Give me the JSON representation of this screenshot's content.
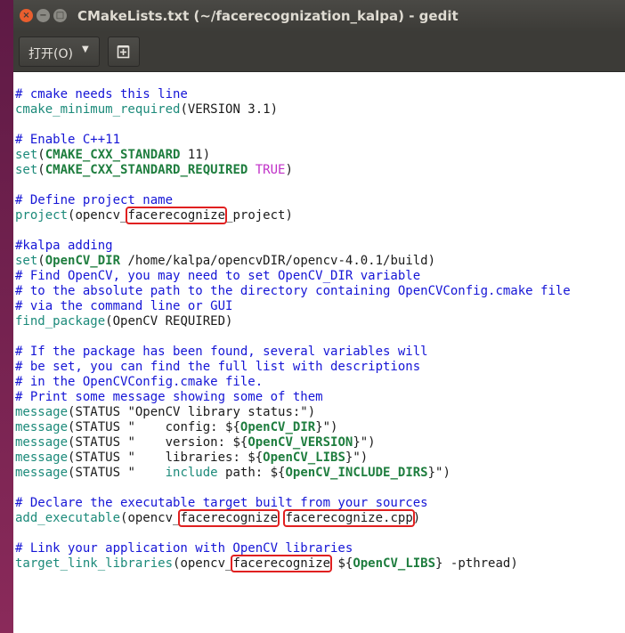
{
  "window": {
    "title": "CMakeLists.txt (~/facerecognization_kalpa) - gedit",
    "close_glyph": "×",
    "min_glyph": "−",
    "max_glyph": "□"
  },
  "toolbar": {
    "open_label": "打开(O)",
    "open_arrow": "▼",
    "new_document_icon": "new-document-icon"
  },
  "code": {
    "l1": "# cmake needs this line",
    "l2a": "cmake_minimum_required",
    "l2b": "(VERSION 3.1)",
    "l4": "# Enable C++11",
    "l5a": "set",
    "l5b": "(",
    "l5c": "CMAKE_CXX_STANDARD",
    "l5d": " 11)",
    "l6a": "set",
    "l6b": "(",
    "l6c": "CMAKE_CXX_STANDARD_REQUIRED",
    "l6d": " ",
    "l6e": "TRUE",
    "l6f": ")",
    "l8": "# Define project name",
    "l9a": "project",
    "l9b": "(opencv_",
    "l9c": "facerecognize",
    "l9d": "_project)",
    "l11": "#kalpa adding",
    "l12a": "set",
    "l12b": "(",
    "l12c": "OpenCV_DIR",
    "l12d": " /home/kalpa/opencvDIR/opencv-4.0.1/build)",
    "l13": "# Find OpenCV, you may need to set OpenCV_DIR variable",
    "l14": "# to the absolute path to the directory containing OpenCVConfig.cmake file",
    "l15": "# via the command line or GUI",
    "l16a": "find_package",
    "l16b": "(OpenCV REQUIRED)",
    "l18": "# If the package has been found, several variables will",
    "l19": "# be set, you can find the full list with descriptions",
    "l20": "# in the OpenCVConfig.cmake file.",
    "l21": "# Print some message showing some of them",
    "l22a": "message",
    "l22b": "(STATUS \"OpenCV library status:\")",
    "l23a": "message",
    "l23b": "(STATUS \"    config: ${",
    "l23c": "OpenCV_DIR",
    "l23d": "}\")",
    "l24a": "message",
    "l24b": "(STATUS \"    version: ${",
    "l24c": "OpenCV_VERSION",
    "l24d": "}\")",
    "l25a": "message",
    "l25b": "(STATUS \"    libraries: ${",
    "l25c": "OpenCV_LIBS",
    "l25d": "}\")",
    "l26a": "message",
    "l26b": "(STATUS \"    ",
    "l26c": "include",
    "l26d": " path: ${",
    "l26e": "OpenCV_INCLUDE_DIRS",
    "l26f": "}\")",
    "l28": "# Declare the executable target built from your sources",
    "l29a": "add_executable",
    "l29b": "(opencv_",
    "l29c": "facerecognize",
    "l29d": " ",
    "l29e": "facerecognize.cpp",
    "l29f": ")",
    "l31": "# Link your application with OpenCV libraries",
    "l32a": "target_link_libraries",
    "l32b": "(opencv_",
    "l32c": "facerecognize",
    "l32d": " ${",
    "l32e": "OpenCV_LIBS",
    "l32f": "} -pthread)"
  }
}
